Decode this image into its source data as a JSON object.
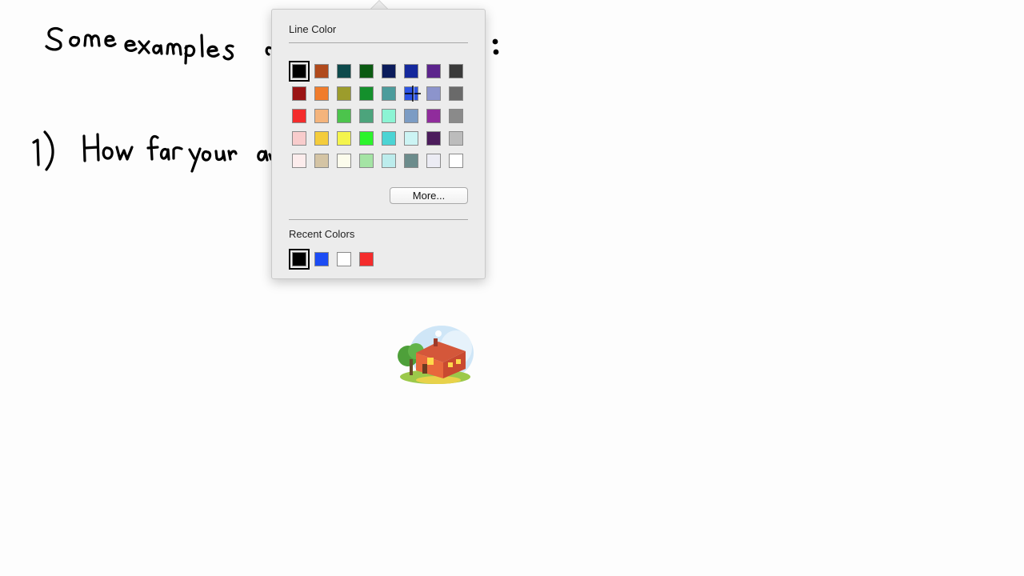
{
  "popover": {
    "line_color_title": "Line Color",
    "recent_colors_title": "Recent Colors",
    "more_button_label": "More...",
    "palette_rows": [
      [
        "#000000",
        "#b04a1c",
        "#0d4a4c",
        "#0b5a12",
        "#0b1c5c",
        "#14289c",
        "#5c248c",
        "#3a3a3a"
      ],
      [
        "#9a1414",
        "#f07c2c",
        "#9c9c2c",
        "#14902c",
        "#4c9c9c",
        "#2c54e4",
        "#8c94cc",
        "#6a6a6a"
      ],
      [
        "#f42c2c",
        "#f4b47c",
        "#4cc44c",
        "#4ca47c",
        "#8cf4d4",
        "#7c9cc4",
        "#902c9c",
        "#8a8a8a"
      ],
      [
        "#f8cccc",
        "#f4cc3c",
        "#f4f44c",
        "#2cf42c",
        "#4cd4d4",
        "#ccf4f4",
        "#4c1c5c",
        "#bcbcbc"
      ],
      [
        "#fcecec",
        "#d4c4a4",
        "#fcfcec",
        "#a4e4a4",
        "#bcecec",
        "#6c8c8c",
        "#ececf4",
        "#ffffff"
      ]
    ],
    "selected_swatch": "#000000",
    "recent_colors": [
      "#000000",
      "#1c4cf4",
      "#ffffff",
      "#f42c2c"
    ],
    "hovered_swatch": "#2c54e4"
  },
  "canvas": {
    "ink_color": "#000000",
    "clipart_name": "house-clipart"
  }
}
